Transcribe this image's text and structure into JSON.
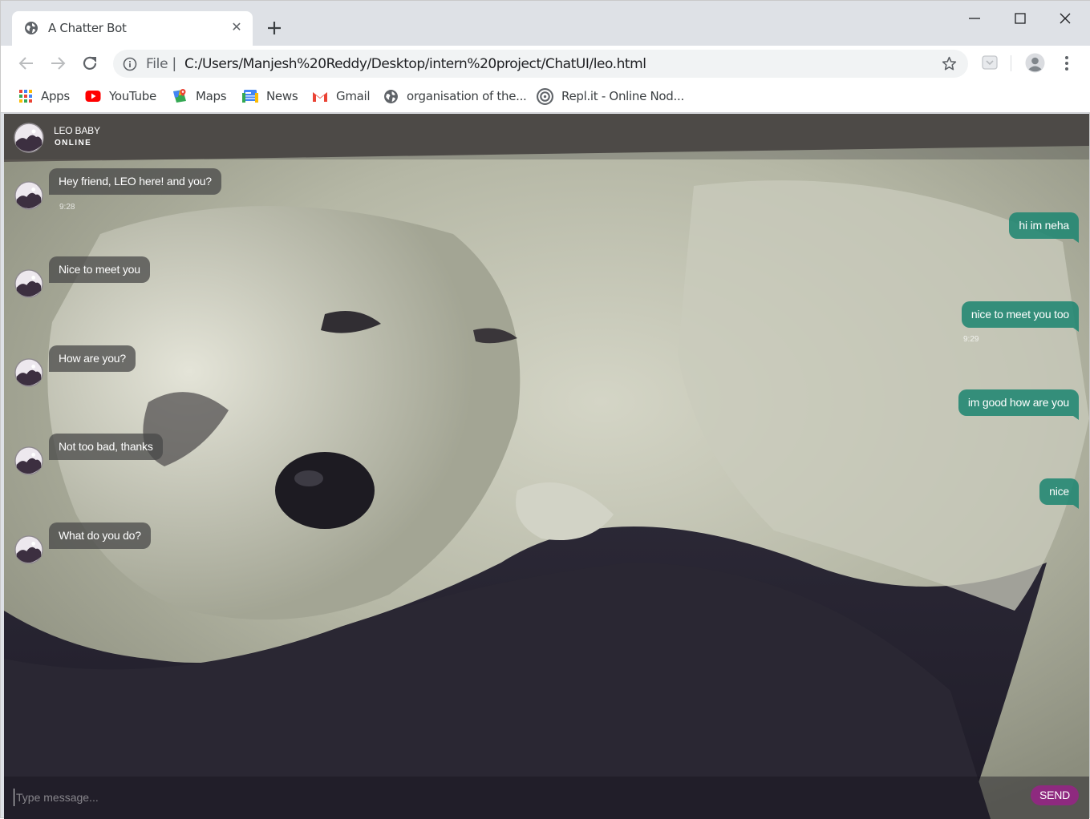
{
  "browser": {
    "tab": {
      "title": "A Chatter Bot",
      "favicon": "globe-icon",
      "close_glyph": "✕"
    },
    "address": {
      "scheme": "File",
      "separator": "|",
      "url": "C:/Users/Manjesh%20Reddy/Desktop/intern%20project/ChatUI/leo.html"
    },
    "bookmarks": [
      {
        "label": "Apps",
        "icon": "apps-grid-icon"
      },
      {
        "label": "YouTube",
        "icon": "youtube-icon"
      },
      {
        "label": "Maps",
        "icon": "maps-icon"
      },
      {
        "label": "News",
        "icon": "news-icon"
      },
      {
        "label": "Gmail",
        "icon": "gmail-icon"
      },
      {
        "label": "organisation of the...",
        "icon": "globe-icon"
      },
      {
        "label": "Repl.it - Online Nod...",
        "icon": "replit-icon"
      }
    ]
  },
  "chat": {
    "header": {
      "name": "LEO BABY",
      "status": "ONLINE"
    },
    "messages": [
      {
        "side": "bot",
        "text": "Hey friend, LEO here! and you?",
        "time": "9:28"
      },
      {
        "side": "user",
        "text": "hi im neha",
        "time": ""
      },
      {
        "side": "bot",
        "text": "Nice to meet you",
        "time": ""
      },
      {
        "side": "user",
        "text": "nice to meet you too",
        "time": "9:29"
      },
      {
        "side": "bot",
        "text": "How are you?",
        "time": ""
      },
      {
        "side": "user",
        "text": "im good how are you",
        "time": ""
      },
      {
        "side": "bot",
        "text": "Not too bad, thanks",
        "time": ""
      },
      {
        "side": "user",
        "text": "nice",
        "time": ""
      },
      {
        "side": "bot",
        "text": "What do you do?",
        "time": ""
      }
    ],
    "input": {
      "placeholder": "Type message...",
      "value": ""
    },
    "send_label": "SEND"
  },
  "colors": {
    "bot_bubble": "#484848",
    "user_bubble": "#208672",
    "send_button": "#8e2a7f",
    "tab_strip": "#dee1e6"
  }
}
